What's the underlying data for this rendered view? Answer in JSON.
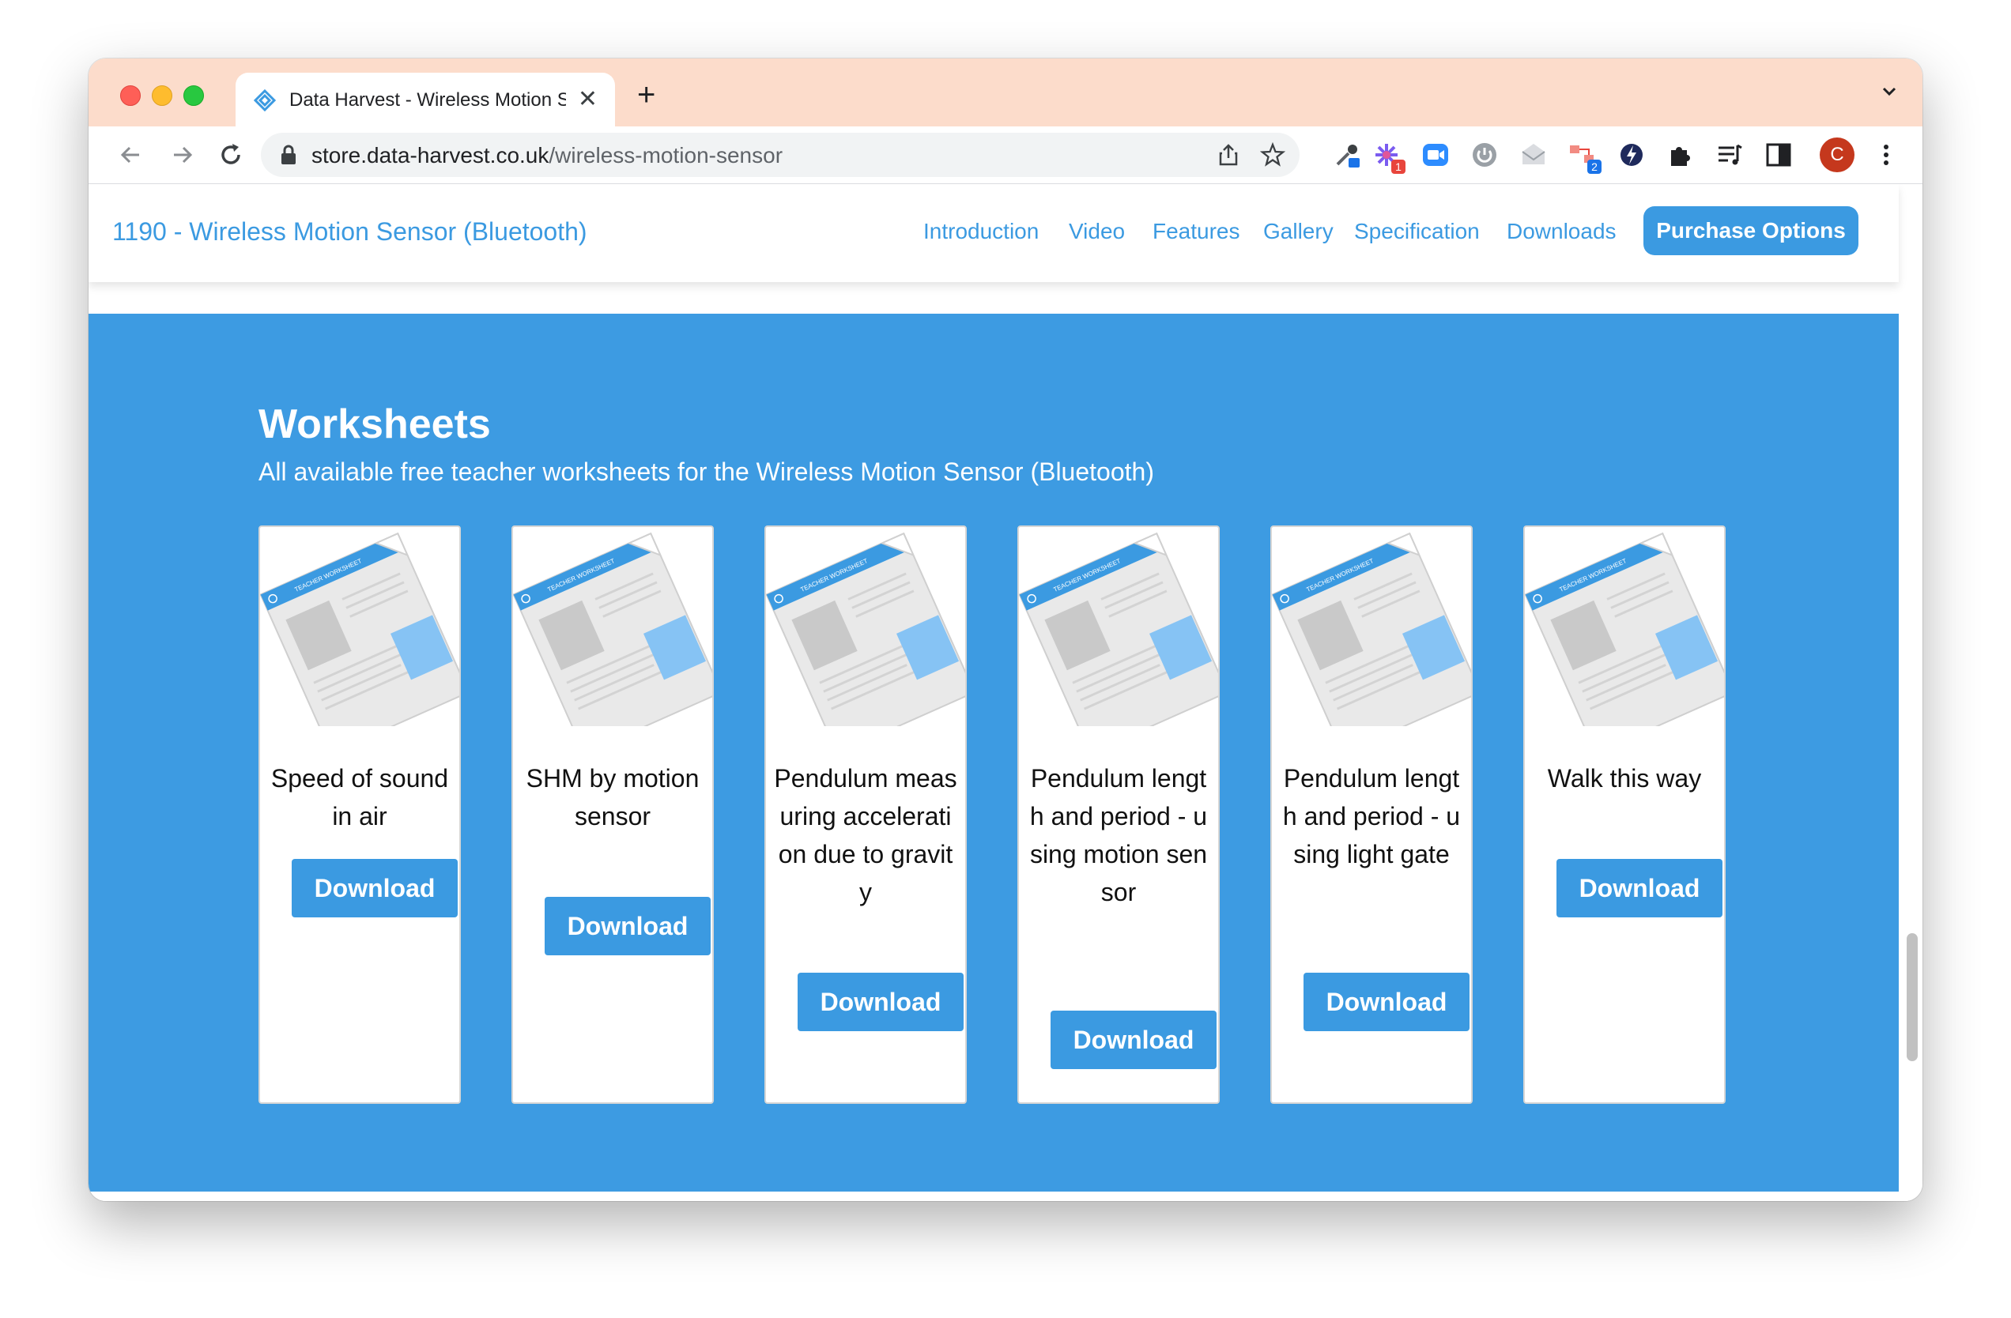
{
  "tab": {
    "title": "Data Harvest - Wireless Motion Sensor (Bluetooth)"
  },
  "omnibox": {
    "domain": "store.data-harvest.co.uk",
    "path": "/wireless-motion-sensor"
  },
  "toolbar_badges": {
    "ext_red": "1",
    "ext_blue": "2"
  },
  "profile": {
    "initial": "C"
  },
  "subnav": {
    "product_title": "1190 - Wireless Motion Sensor (Bluetooth)",
    "links": [
      "Introduction",
      "Video",
      "Features",
      "Gallery",
      "Specification",
      "Downloads"
    ],
    "purchase_label": "Purchase Options"
  },
  "worksheets": {
    "heading": "Worksheets",
    "subheading": "All available free teacher worksheets for the Wireless Motion Sensor (Bluetooth)",
    "download_label": "Download",
    "thumb_label": "TEACHER WORKSHEET",
    "cards": [
      {
        "title": "Speed of sound in air"
      },
      {
        "title": "SHM by motion sensor"
      },
      {
        "title": "Pendulum measuring acceleration due to gravity"
      },
      {
        "title": "Pendulum length and period - using motion sensor"
      },
      {
        "title": "Pendulum length and period - using light gate"
      },
      {
        "title": "Walk this way"
      }
    ]
  },
  "colors": {
    "brand_blue": "#3b9ae1",
    "section_blue": "#3d9be2",
    "tabbar": "#fcdccb"
  }
}
